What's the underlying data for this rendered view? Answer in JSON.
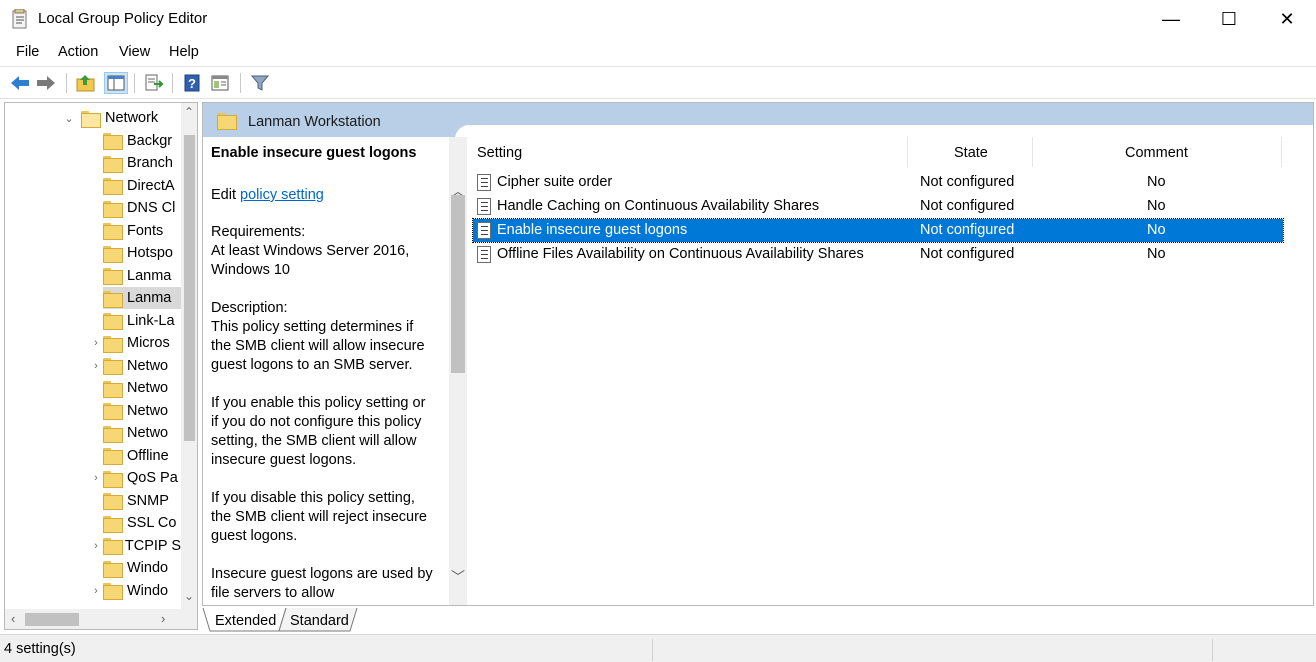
{
  "window": {
    "title": "Local Group Policy Editor",
    "minimize_glyph": "—",
    "maximize_glyph": "☐",
    "close_glyph": "✕"
  },
  "menu": {
    "items": [
      "File",
      "Action",
      "View",
      "Help"
    ]
  },
  "toolbar": {
    "icons": [
      "back-arrow-icon",
      "forward-arrow-icon",
      "up-folder-icon",
      "show-hide-tree-icon",
      "export-list-icon",
      "help-icon",
      "extended-view-icon",
      "filter-icon"
    ]
  },
  "tree": {
    "items": [
      {
        "label": "Network",
        "expander": "⌄",
        "open": true
      },
      {
        "label": "Backgr",
        "expander": ""
      },
      {
        "label": "Branch",
        "expander": ""
      },
      {
        "label": "DirectA",
        "expander": ""
      },
      {
        "label": "DNS Cl",
        "expander": ""
      },
      {
        "label": "Fonts",
        "expander": ""
      },
      {
        "label": "Hotspo",
        "expander": ""
      },
      {
        "label": "Lanma",
        "expander": ""
      },
      {
        "label": "Lanma",
        "expander": "",
        "selected": true
      },
      {
        "label": "Link-La",
        "expander": ""
      },
      {
        "label": "Micros",
        "expander": "›"
      },
      {
        "label": "Netwo",
        "expander": "›"
      },
      {
        "label": "Netwo",
        "expander": ""
      },
      {
        "label": "Netwo",
        "expander": ""
      },
      {
        "label": "Netwo",
        "expander": ""
      },
      {
        "label": "Offline",
        "expander": ""
      },
      {
        "label": "QoS Pa",
        "expander": "›"
      },
      {
        "label": "SNMP",
        "expander": ""
      },
      {
        "label": "SSL Co",
        "expander": ""
      },
      {
        "label": "TCPIP S",
        "expander": "›"
      },
      {
        "label": "Windo",
        "expander": ""
      },
      {
        "label": "Windo",
        "expander": "›"
      }
    ]
  },
  "header": {
    "title": "Lanman Workstation"
  },
  "description": {
    "title": "Enable insecure guest logons",
    "edit_prefix": "Edit ",
    "edit_link": "policy setting ",
    "body": "Requirements:\nAt least Windows Server 2016,\nWindows 10\n\nDescription:\nThis policy setting determines if\nthe SMB client will allow insecure\nguest logons to an SMB server.\n\nIf you enable this policy setting or\nif you do not configure this policy\nsetting, the SMB client will allow\ninsecure guest logons.\n\nIf you disable this policy setting,\nthe SMB client will reject insecure\nguest logons.\n\nInsecure guest logons are used by\nfile servers to allow\nunauthenticated access to shared"
  },
  "settings": {
    "columns": {
      "setting": "Setting",
      "state": "State",
      "comment": "Comment"
    },
    "rows": [
      {
        "name": "Cipher suite order",
        "state": "Not configured",
        "comment": "No"
      },
      {
        "name": "Handle Caching on Continuous Availability Shares",
        "state": "Not configured",
        "comment": "No"
      },
      {
        "name": "Enable insecure guest logons",
        "state": "Not configured",
        "comment": "No",
        "selected": true
      },
      {
        "name": "Offline Files Availability on Continuous Availability Shares",
        "state": "Not configured",
        "comment": "No"
      }
    ]
  },
  "tabs": [
    "Extended",
    "Standard"
  ],
  "status": {
    "text": "4 setting(s)"
  }
}
